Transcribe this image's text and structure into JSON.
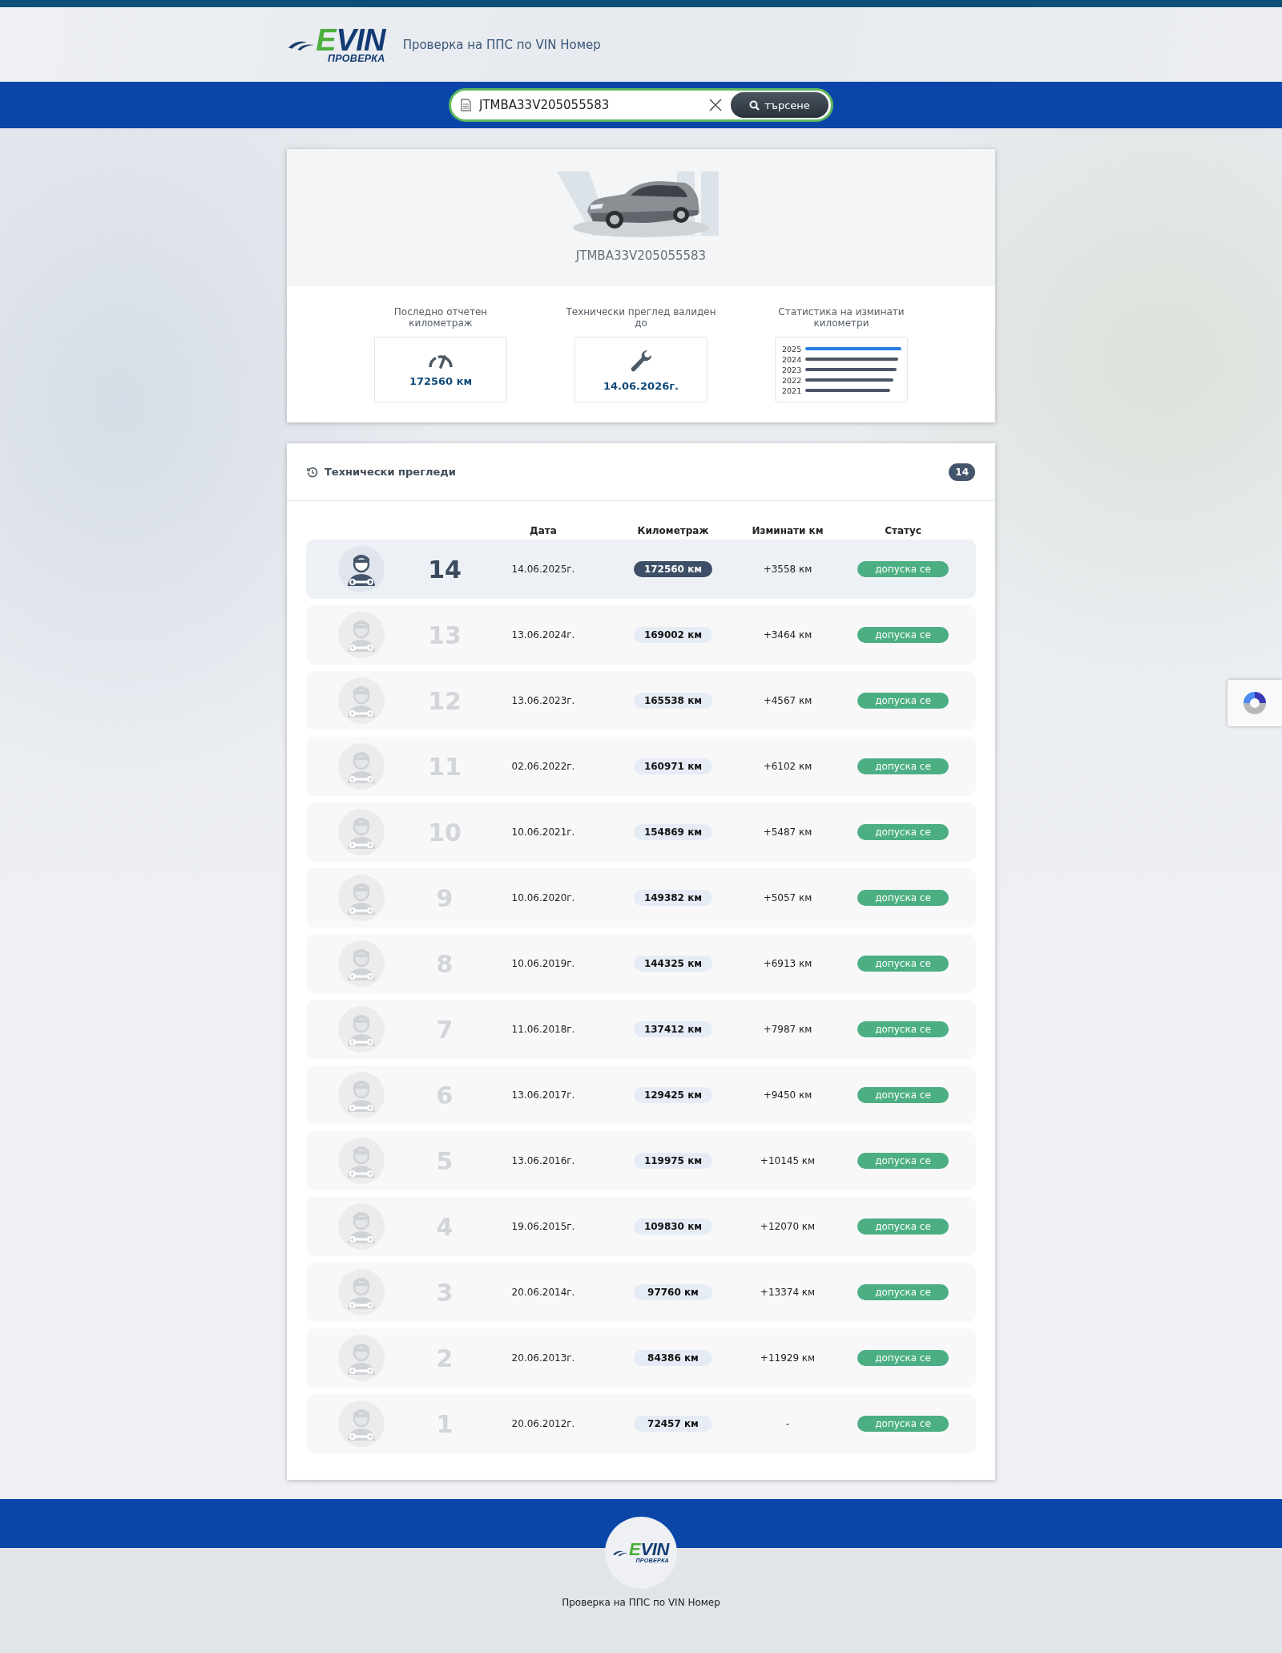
{
  "header": {
    "logo": {
      "accent": "E",
      "name": "VIN",
      "tagline": "ПРОВЕРКА"
    },
    "subtitle": "Проверка на ППС по VIN Номер"
  },
  "search": {
    "value": "JTMBA33V205055583",
    "button": "търсене"
  },
  "vehicle": {
    "vin": "JTMBA33V205055583",
    "stats": [
      {
        "kind": "mileage",
        "label": "Последно отчетен километраж",
        "value": "172560 км"
      },
      {
        "kind": "inspection",
        "label": "Технически преглед валиден до",
        "value": "14.06.2026г."
      },
      {
        "kind": "chart",
        "label": "Статистика на изминати километри",
        "years": [
          {
            "label": "2025",
            "highlighted": true
          },
          {
            "label": "2024",
            "highlighted": false
          },
          {
            "label": "2023",
            "highlighted": false
          },
          {
            "label": "2022",
            "highlighted": false
          },
          {
            "label": "2021",
            "highlighted": false
          }
        ]
      }
    ]
  },
  "inspections": {
    "title": "Технически прегледи",
    "count": "14",
    "columns": [
      "Дата",
      "Километраж",
      "Изминати км",
      "Статус"
    ],
    "rows": [
      {
        "number": "14",
        "date": "14.06.2025г.",
        "mileage": "172560 км",
        "change": "+3558 км",
        "status": "допуска се",
        "selected": true
      },
      {
        "number": "13",
        "date": "13.06.2024г.",
        "mileage": "169002 км",
        "change": "+3464 км",
        "status": "допуска се",
        "selected": false
      },
      {
        "number": "12",
        "date": "13.06.2023г.",
        "mileage": "165538 км",
        "change": "+4567 км",
        "status": "допуска се",
        "selected": false
      },
      {
        "number": "11",
        "date": "02.06.2022г.",
        "mileage": "160971 км",
        "change": "+6102 км",
        "status": "допуска се",
        "selected": false
      },
      {
        "number": "10",
        "date": "10.06.2021г.",
        "mileage": "154869 км",
        "change": "+5487 км",
        "status": "допуска се",
        "selected": false
      },
      {
        "number": "9",
        "date": "10.06.2020г.",
        "mileage": "149382 км",
        "change": "+5057 км",
        "status": "допуска се",
        "selected": false
      },
      {
        "number": "8",
        "date": "10.06.2019г.",
        "mileage": "144325 км",
        "change": "+6913 км",
        "status": "допуска се",
        "selected": false
      },
      {
        "number": "7",
        "date": "11.06.2018г.",
        "mileage": "137412 км",
        "change": "+7987 км",
        "status": "допуска се",
        "selected": false
      },
      {
        "number": "6",
        "date": "13.06.2017г.",
        "mileage": "129425 км",
        "change": "+9450 км",
        "status": "допуска се",
        "selected": false
      },
      {
        "number": "5",
        "date": "13.06.2016г.",
        "mileage": "119975 км",
        "change": "+10145 км",
        "status": "допуска се",
        "selected": false
      },
      {
        "number": "4",
        "date": "19.06.2015г.",
        "mileage": "109830 км",
        "change": "+12070 км",
        "status": "допуска се",
        "selected": false
      },
      {
        "number": "3",
        "date": "20.06.2014г.",
        "mileage": "97760 км",
        "change": "+13374 км",
        "status": "допуска се",
        "selected": false
      },
      {
        "number": "2",
        "date": "20.06.2013г.",
        "mileage": "84386 км",
        "change": "+11929 км",
        "status": "допуска се",
        "selected": false
      },
      {
        "number": "1",
        "date": "20.06.2012г.",
        "mileage": "72457 км",
        "change": "-",
        "status": "допуска се",
        "selected": false
      }
    ]
  },
  "footer": {
    "logo": {
      "accent": "E",
      "name": "VIN",
      "tagline": "ПРОВЕРКА"
    },
    "text": "Проверка на ППС по VIN Номер"
  }
}
